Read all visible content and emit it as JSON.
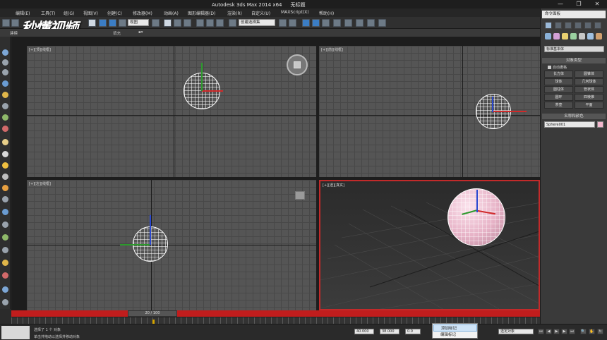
{
  "titlebar": {
    "app_title": "Autodesk 3ds Max  2014 x64",
    "file_title": "无标题",
    "minimize": "—",
    "maximize": "❐",
    "close": "✕"
  },
  "menu": [
    "编辑(E)",
    "工具(T)",
    "组(G)",
    "视图(V)",
    "创建(C)",
    "修改器(M)",
    "动画(A)",
    "图形编辑器(D)",
    "渲染(R)",
    "自定义(U)",
    "MAXScript(X)",
    "帮助(H)"
  ],
  "toolbar": {
    "view_select": "视图",
    "selection_set": "创建选择集"
  },
  "ribbon": [
    "建模",
    "自由形式",
    "选择",
    "对象绘制",
    "填充"
  ],
  "watermark": "秒懂视频",
  "viewports": {
    "top": "[+][顶][线框]",
    "front": "[+][前][线框]",
    "left": "[+][左][线框]",
    "perspective": "[+][透][真实]"
  },
  "command_panel": {
    "header": "命令面板",
    "dropdown": "标准基本体",
    "rollout_object_type": "对象类型",
    "autogrid": "自动栅格",
    "buttons": [
      "长方体",
      "圆锥体",
      "球体",
      "几何球体",
      "圆柱体",
      "管状体",
      "圆环",
      "四棱锥",
      "茶壶",
      "平面"
    ],
    "rollout_name_color": "名称和颜色",
    "object_name": "Sphere001",
    "object_color": "#f4b8ce"
  },
  "timeline": {
    "frame": "20 / 100"
  },
  "status": {
    "selection": "选择了 1 个 对象",
    "prompt": "单击并拖动以选择并移动对象",
    "x": "40.000",
    "y": "38.000",
    "z": "0.0",
    "set_key_dropdown": "选定对象"
  },
  "popup": {
    "item_add": "添加标记",
    "item_edit": "编辑标记"
  },
  "colors": {
    "accent_red": "#c11d1d",
    "active_border": "#c22a2a",
    "sphere_pink": "#e7b3c7"
  }
}
